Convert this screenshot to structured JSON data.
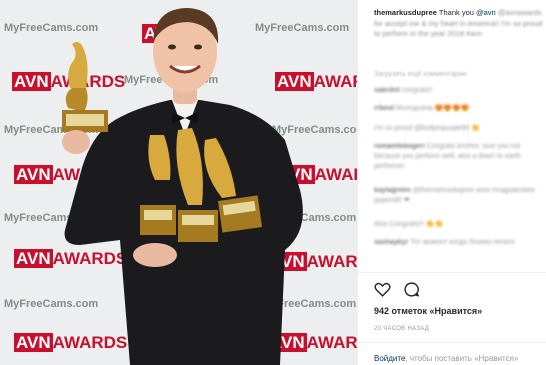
{
  "photo": {
    "backdrop_logo_text": "AVNAWARDS",
    "backdrop_logo_box": "AVN",
    "backdrop_logo_rest": "AWARDS",
    "backdrop_sponsor_text": "MyFreeCams.com"
  },
  "post": {
    "username": "themarkusdupree",
    "caption_text": "Thank you",
    "caption_mention": "@avn",
    "caption_blurred": "@avnawards for accept me & my heart in America!! I'm so proud to perform in the year 2018",
    "caption_hashtag": "#avn",
    "load_more": "Загрузить ещё комментарии",
    "comments": [
      {
        "user": "sabrdnt",
        "text": "congrats!!"
      },
      {
        "user": "rrbest",
        "text": "Молодчина 😍😍😍😍"
      },
      {
        "user": "",
        "text": "I'm so proud @bodyinpurple99 👏"
      },
      {
        "user": "romaintokegeri",
        "text": "Congrats brother, love you not because you perform well, also a down to earth performer."
      },
      {
        "user": "kaylagreen",
        "text": "@themarkusdupree wow поздравляем дорогой! ❤"
      },
      {
        "user": "",
        "text": "Also Congrats!!! 👏👏"
      },
      {
        "user": "sashaykyr",
        "text": "Тот момент когда Лоинко нечего"
      }
    ],
    "likes": "942 отметок «Нравится»",
    "timestamp": "20 ЧАСОВ НАЗАД",
    "add_comment_link": "Войдите",
    "add_comment_rest": ", чтобы поставить «Нравится»"
  },
  "colors": {
    "accent_link": "#003569",
    "backdrop": "#eceef0",
    "logo_red": "#c8102e"
  },
  "icons": [
    "heart-icon",
    "comment-icon"
  ]
}
